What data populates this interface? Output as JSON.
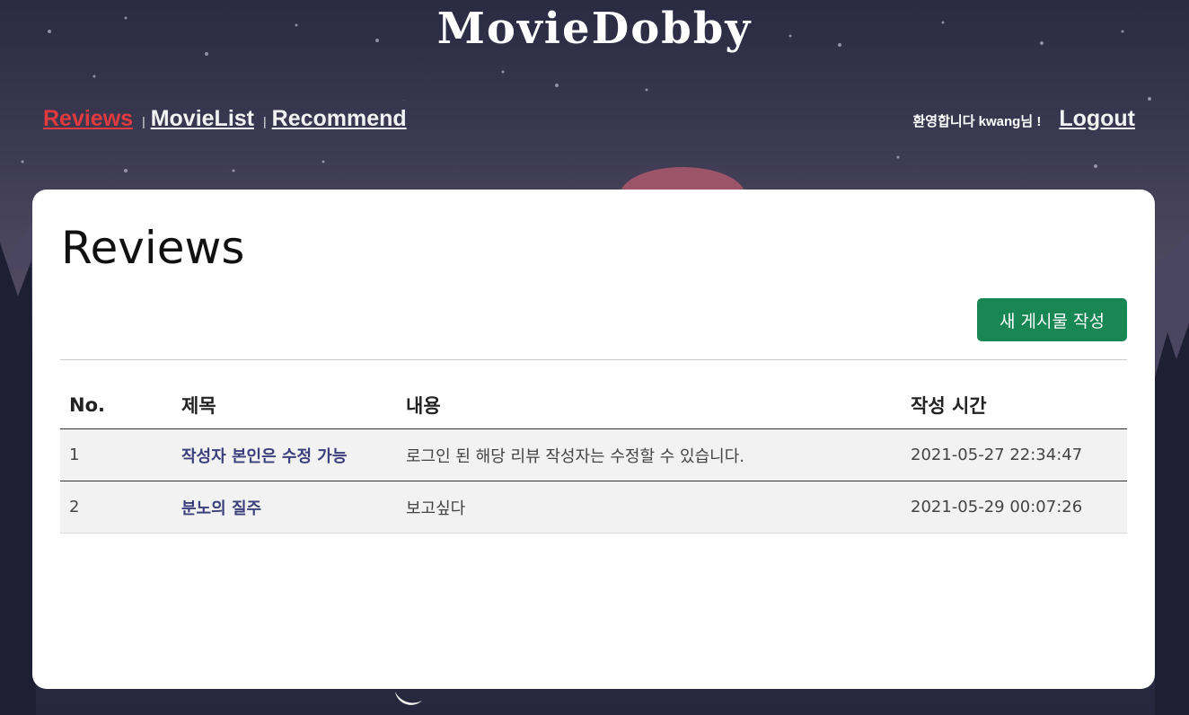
{
  "header": {
    "site_title": "MovieDobby"
  },
  "nav": {
    "items": [
      {
        "label": "Reviews",
        "active": true
      },
      {
        "label": "MovieList",
        "active": false
      },
      {
        "label": "Recommend",
        "active": false
      }
    ],
    "separator": "|"
  },
  "user": {
    "welcome": "환영합니다 kwang님 !",
    "logout": "Logout"
  },
  "main": {
    "heading": "Reviews",
    "new_post_button": "새 게시물 작성",
    "table": {
      "columns": [
        "No.",
        "제목",
        "내용",
        "작성 시간"
      ],
      "rows": [
        {
          "no": "1",
          "title": "작성자 본인은 수정 가능",
          "content": "로그인 된 해당 리뷰 작성자는 수정할 수 있습니다.",
          "time": "2021-05-27 22:34:47"
        },
        {
          "no": "2",
          "title": "분노의 질주",
          "content": "보고싶다",
          "time": "2021-05-29 00:07:26"
        }
      ]
    }
  },
  "colors": {
    "active_nav": "#e0393e",
    "button": "#198754",
    "title_link": "#3b3f7c",
    "row_bg": "#f2f2f2"
  }
}
